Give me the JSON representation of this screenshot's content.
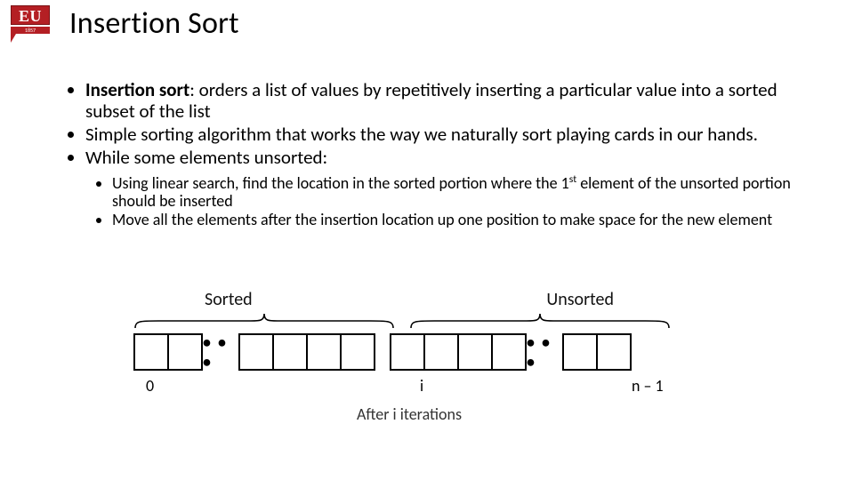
{
  "logo": {
    "text": "EU",
    "year": "1857"
  },
  "title": "Insertion Sort",
  "bullets": {
    "b1_strong": "Insertion sort",
    "b1_rest": ": orders a list of values by repetitively inserting a particular value into a sorted subset of the list",
    "b2": "Simple sorting algorithm that works the way we naturally sort playing cards in our hands.",
    "b3": "While some elements unsorted:",
    "s1_a": "Using linear search, find the location in the sorted portion where the 1",
    "s1_sup": "st",
    "s1_b": " element of the unsorted portion should be inserted",
    "s2": "Move all the elements after the insertion location up one position to make space for the new element"
  },
  "diagram": {
    "label_sorted": "Sorted",
    "label_unsorted": "Unsorted",
    "ellipsis": "• • •",
    "idx_start": "0",
    "idx_mid": "i",
    "idx_end": "n – 1",
    "caption": "After i iterations"
  }
}
